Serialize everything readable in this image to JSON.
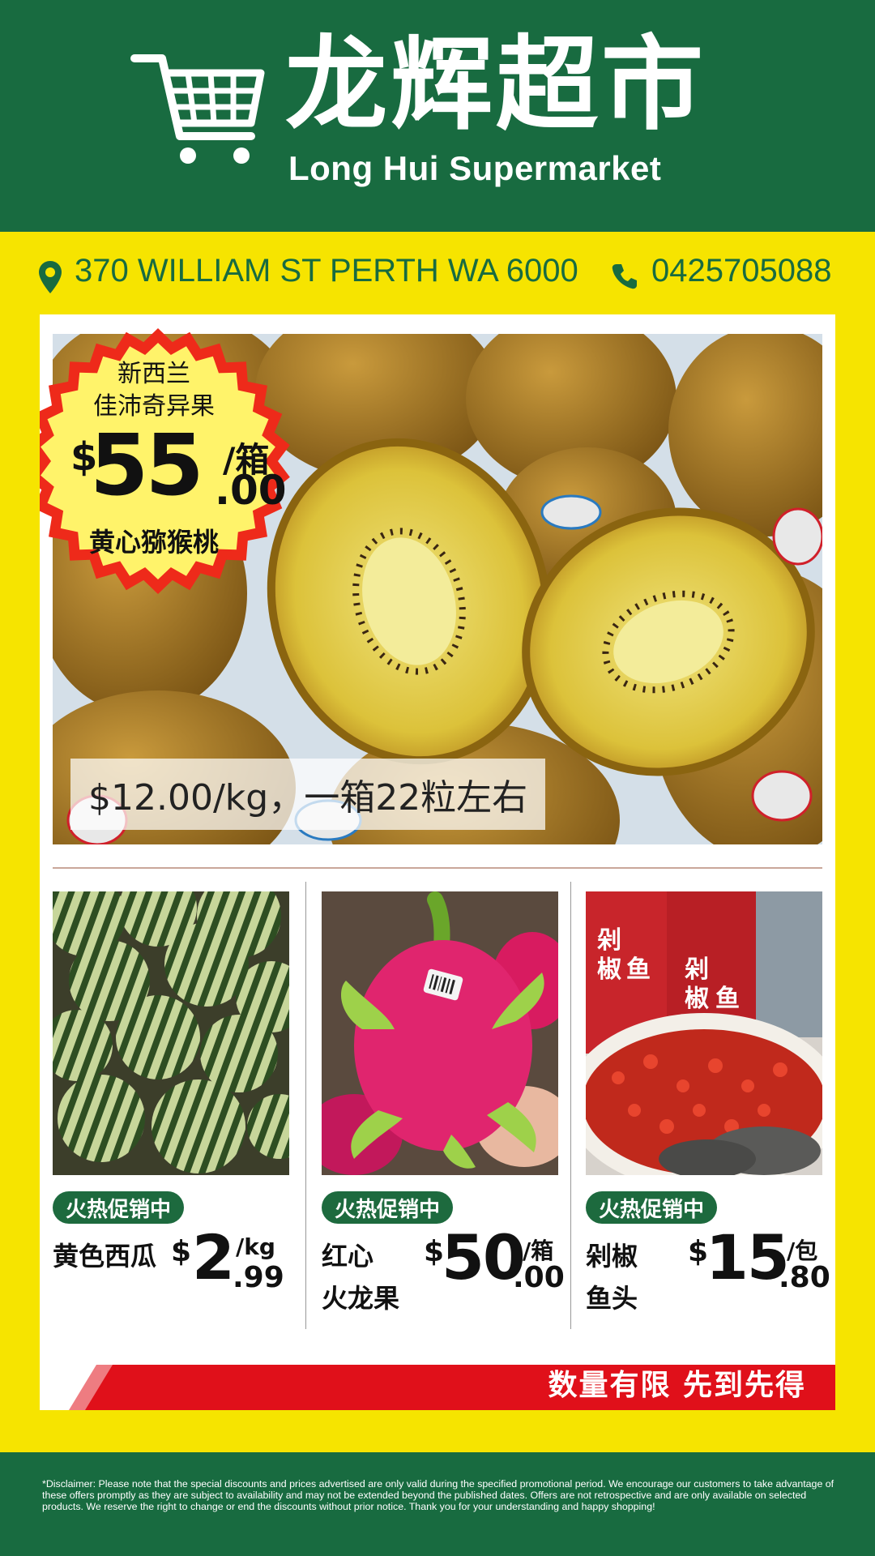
{
  "brand": {
    "name_cn": "龙辉超市",
    "name_en": "Long Hui Supermarket",
    "icon": "shopping-cart-icon"
  },
  "contact": {
    "address": "370 WILLIAM ST PERTH WA 6000",
    "phone": "0425705088",
    "address_icon": "location-pin-icon",
    "phone_icon": "phone-icon"
  },
  "featured": {
    "origin": "新西兰",
    "brand": "佳沛奇异果",
    "price_dollar": "$",
    "price_main": "55",
    "price_unit": "/箱",
    "price_cents": ".00",
    "title": "黄心猕猴桃",
    "caption": "$12.00/kg，一箱22粒左右"
  },
  "products": [
    {
      "badge": "火热促销中",
      "name": "黄色西瓜",
      "price_dollar": "$",
      "price_main": "2",
      "price_unit": "/kg",
      "price_cents": ".99"
    },
    {
      "badge": "火热促销中",
      "name_line1": "红心",
      "name_line2": "火龙果",
      "price_dollar": "$",
      "price_main": "50",
      "price_unit": "/箱",
      "price_cents": ".00"
    },
    {
      "badge": "火热促销中",
      "name_line1": "剁椒",
      "name_line2": "鱼头",
      "price_dollar": "$",
      "price_main": "15",
      "price_unit": "/包",
      "price_cents": ".80"
    }
  ],
  "banner": "数量有限  先到先得",
  "disclaimer": "*Disclaimer: Please note that the special discounts and prices advertised are only valid during the specified promotional period. We encourage our customers to take advantage of these offers promptly as they are subject to availability and may not be extended beyond the published dates. Offers are not retrospective and are only available on selected products. We reserve the right to  change or end the discounts without prior notice. Thank you for your understanding and happy shopping!",
  "colors": {
    "header_green": "#186b40",
    "background_yellow": "#f6e400",
    "burst_red": "#ee2a1a",
    "banner_red": "#e0101a",
    "badge_green": "#1d6a3e"
  }
}
